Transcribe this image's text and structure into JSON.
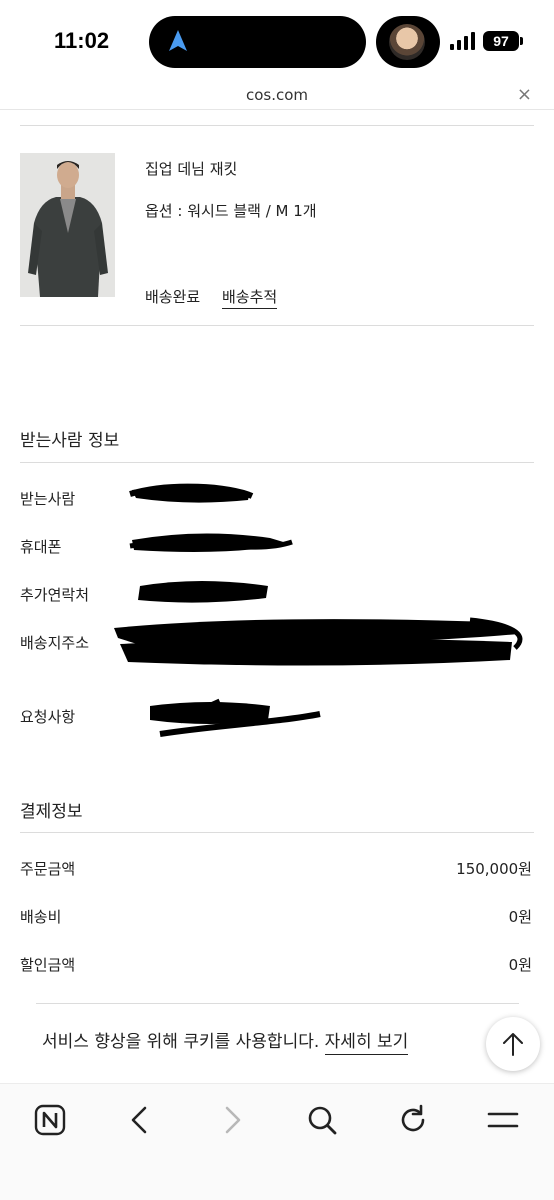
{
  "status_bar": {
    "time": "11:02",
    "battery": "97"
  },
  "browser": {
    "url": "cos.com",
    "close_label": "×"
  },
  "order_item": {
    "name": "집업 데님 재킷",
    "option": "옵션 : 워시드 블랙 / M 1개",
    "status": "배송완료",
    "track_label": "배송추적"
  },
  "recipient": {
    "title": "받는사람 정보",
    "rows": [
      {
        "label": "받는사람"
      },
      {
        "label": "휴대폰"
      },
      {
        "label": "추가연락처"
      },
      {
        "label": "배송지주소"
      },
      {
        "label": "요청사항"
      }
    ]
  },
  "payment": {
    "title": "결제정보",
    "rows": [
      {
        "label": "주문금액",
        "value": "150,000원"
      },
      {
        "label": "배송비",
        "value": "0원"
      },
      {
        "label": "할인금액",
        "value": "0원"
      }
    ]
  },
  "cookie_banner": {
    "text": "서비스 향상을 위해 쿠키를 사용합니다. ",
    "link": "자세히 보기"
  },
  "toolbar": {
    "icons": [
      "naver-n-icon",
      "back-icon",
      "forward-icon",
      "search-icon",
      "reload-icon",
      "menu-icon"
    ]
  },
  "colors": {
    "text": "#222222",
    "divider": "#dcdcdc",
    "redaction": "#000000",
    "forward_disabled": "#b8b8b8"
  }
}
